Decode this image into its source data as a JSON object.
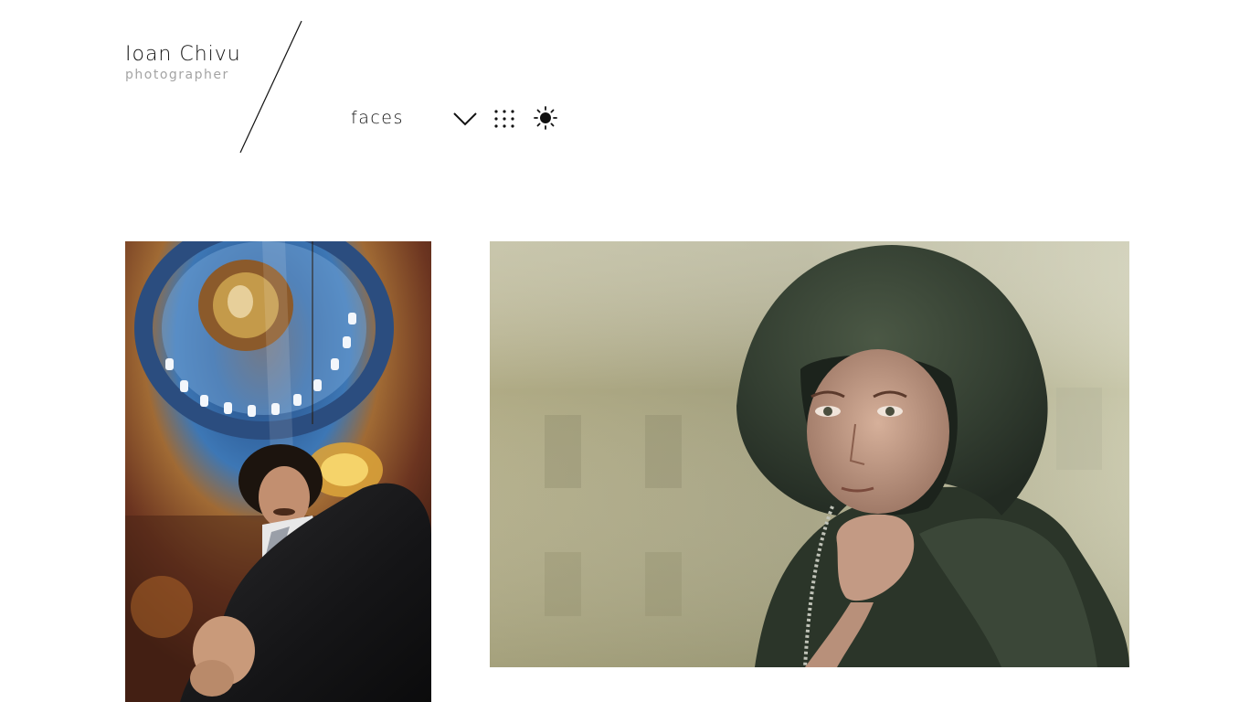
{
  "brand": {
    "name": "Ioan Chivu",
    "subtitle": "photographer"
  },
  "nav": {
    "gallery_label": "faces",
    "dropdown_icon": "chevron-down-icon",
    "grid_icon": "grid-dots-icon",
    "theme_icon": "sun-icon"
  },
  "gallery": {
    "photos": [
      {
        "subject": "man in suit beneath painted church dome"
      },
      {
        "subject": "woman in dark green hood"
      }
    ]
  },
  "colors": {
    "text": "#111111",
    "subtitle": "#a4a4a4",
    "background": "#ffffff"
  }
}
